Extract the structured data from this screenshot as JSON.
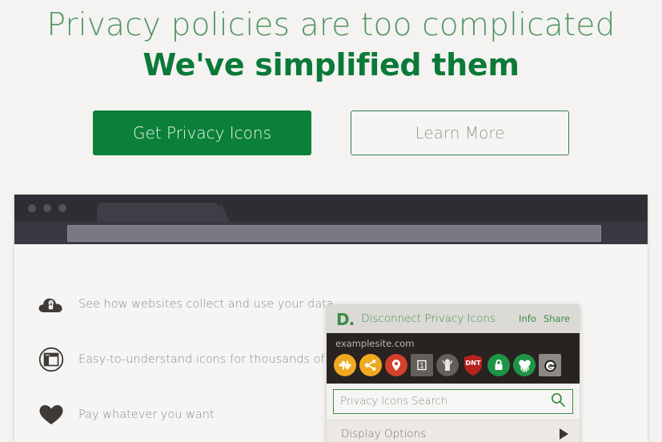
{
  "hero": {
    "line1": "Privacy policies are too complicated",
    "line2": "We've simplified them"
  },
  "cta": {
    "primary_label": "Get Privacy Icons",
    "secondary_label": "Learn More"
  },
  "browser": {
    "tab_label": "",
    "address_value": ""
  },
  "features": [
    {
      "icon": "cloud-lock-icon",
      "text": "See how websites collect and use your data"
    },
    {
      "icon": "browser-window-icon",
      "text": "Easy-to-understand icons for thousands of sites"
    },
    {
      "icon": "heart-icon",
      "text": "Pay whatever you want"
    }
  ],
  "popup": {
    "logo": "D.",
    "title": "Disconnect Privacy Icons",
    "links": [
      {
        "label": "Info"
      },
      {
        "label": "Share"
      }
    ],
    "site_name": "examplesite.com",
    "icons": [
      {
        "name": "data-transfer-icon",
        "color": "#f0a81e",
        "glyph": "updown-arrows"
      },
      {
        "name": "data-sharing-icon",
        "color": "#f0a81e",
        "glyph": "share-nodes"
      },
      {
        "name": "location-icon",
        "color": "#d3402c",
        "glyph": "map-pin"
      },
      {
        "name": "retention-icon",
        "color": "#63605c",
        "glyph": "1",
        "label": "1"
      },
      {
        "name": "child-privacy-icon",
        "color": "#63605c",
        "glyph": "person-arms-up"
      },
      {
        "name": "do-not-track-icon",
        "color": "#b4231f",
        "glyph": "DNT",
        "label": "DNT"
      },
      {
        "name": "encryption-lock-icon",
        "color": "#1f9447",
        "glyph": "padlock"
      },
      {
        "name": "heartbleed-icon",
        "color": "#1f9447",
        "glyph": "bleeding-heart"
      },
      {
        "name": "tracking-protection-icon",
        "color": "#8d8a84",
        "glyph": "e"
      }
    ],
    "search_placeholder": "Privacy Icons Search",
    "display_options_label": "Display Options"
  },
  "colors": {
    "page_bg": "#f4f3f1",
    "brand_green": "#0b8039",
    "hero_green_light": "#4f9460",
    "hero_green_dark": "#0b7a38",
    "popup_dark": "#282220",
    "popup_header": "#dcdad6"
  }
}
